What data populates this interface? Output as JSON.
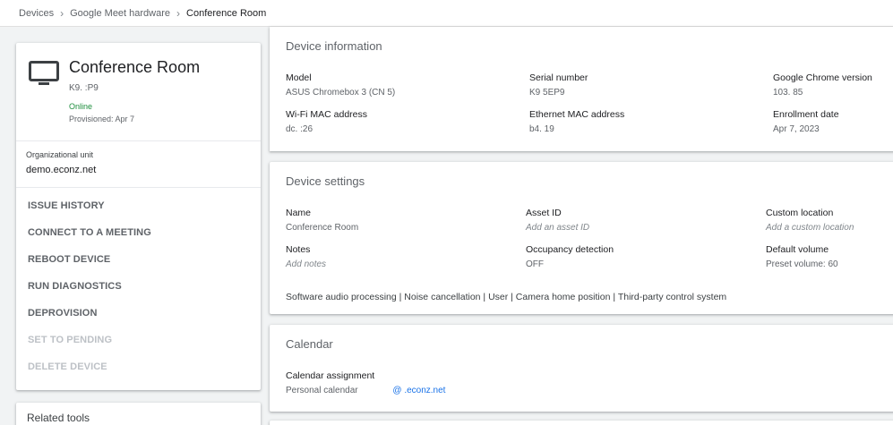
{
  "breadcrumb": {
    "items": [
      "Devices",
      "Google Meet hardware"
    ],
    "current": "Conference Room"
  },
  "device": {
    "icon": "tv-icon",
    "name": "Conference Room",
    "serial": "K9.               :P9",
    "status": "Online",
    "provisioned": "Provisioned: Apr 7"
  },
  "org_unit": {
    "label": "Organizational unit",
    "value": "demo.econz.net"
  },
  "actions": [
    {
      "label": "ISSUE HISTORY",
      "enabled": true
    },
    {
      "label": "CONNECT TO A MEETING",
      "enabled": true
    },
    {
      "label": "REBOOT DEVICE",
      "enabled": true
    },
    {
      "label": "RUN DIAGNOSTICS",
      "enabled": true
    },
    {
      "label": "DEPROVISION",
      "enabled": true
    },
    {
      "label": "SET TO PENDING",
      "enabled": false
    },
    {
      "label": "DELETE DEVICE",
      "enabled": false
    }
  ],
  "related_tools": "Related tools",
  "device_info": {
    "title": "Device information",
    "fields": [
      {
        "label": "Model",
        "value": "ASUS Chromebox 3 (CN   5)"
      },
      {
        "label": "Serial number",
        "value": "K9                  5EP9"
      },
      {
        "label": "Google Chrome version",
        "value": "103.         85"
      },
      {
        "label": "Wi-Fi MAC address",
        "value": "dc.                  :26"
      },
      {
        "label": "Ethernet MAC address",
        "value": "b4.                  19"
      },
      {
        "label": "Enrollment date",
        "value": "Apr 7, 2023"
      }
    ]
  },
  "device_settings": {
    "title": "Device settings",
    "fields": [
      {
        "label": "Name",
        "value": "Conference Room",
        "placeholder": false
      },
      {
        "label": "Asset ID",
        "value": "Add an asset ID",
        "placeholder": true
      },
      {
        "label": "Custom location",
        "value": "Add a custom location",
        "placeholder": true
      },
      {
        "label": "Notes",
        "value": "Add notes",
        "placeholder": true
      },
      {
        "label": "Occupancy detection",
        "value": "OFF",
        "placeholder": false
      },
      {
        "label": "Default volume",
        "value": "Preset volume: 60",
        "placeholder": false
      }
    ],
    "features": "Software audio processing | Noise cancellation | User | Camera home position | Third-party control system"
  },
  "calendar": {
    "title": "Calendar",
    "assignment_label": "Calendar assignment",
    "assignment_type": "Personal calendar",
    "assignment_email": "@       .econz.net"
  },
  "colors": {
    "online": "#1e8e3e",
    "link": "#1a73e8",
    "disabled": "#bdc1c6"
  }
}
